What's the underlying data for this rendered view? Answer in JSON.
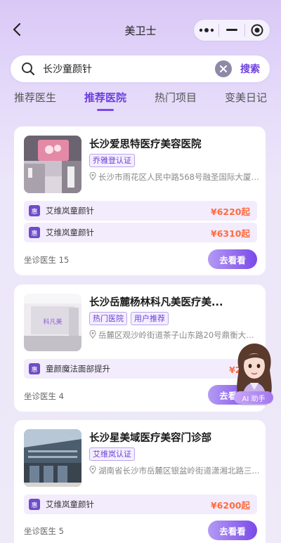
{
  "nav": {
    "title": "美卫士"
  },
  "search": {
    "query": "长沙童颜针",
    "button_label": "搜索"
  },
  "tabs": [
    {
      "label": "推荐医生",
      "active": false
    },
    {
      "label": "推荐医院",
      "active": true
    },
    {
      "label": "热门项目",
      "active": false
    },
    {
      "label": "变美日记",
      "active": false
    }
  ],
  "hospitals": [
    {
      "name": "长沙爱思特医疗美容医院",
      "tags": [
        "乔雅登认证"
      ],
      "address": "长沙市雨花区人民中路568号融圣国际大厦1...",
      "projects": [
        {
          "icon_text": "惠",
          "name": "艾维岚童颜针",
          "price": "¥6220起"
        },
        {
          "icon_text": "惠",
          "name": "艾维岚童颜针",
          "price": "¥6310起"
        }
      ],
      "doctor_count": "坐诊医生 15",
      "go_label": "去看看"
    },
    {
      "name": "长沙岳麓杨林科凡美医疗美...",
      "tags": [
        "热门医院",
        "用户推荐"
      ],
      "address": "岳麓区观沙岭街道茶子山东路20号鼎衡大厦6...",
      "projects": [
        {
          "icon_text": "惠",
          "name": "童颜魔法面部提升",
          "price": "¥2九"
        }
      ],
      "doctor_count": "坐诊医生 4",
      "go_label": "去看看"
    },
    {
      "name": "长沙星美域医疗美容门诊部",
      "tags": [
        "艾维岚认证"
      ],
      "address": "湖南省长沙市岳麓区银盆岭街道潇湘北路三...",
      "projects": [
        {
          "icon_text": "惠",
          "name": "艾维岚童颜针",
          "price": "¥6200起"
        }
      ],
      "doctor_count": "坐诊医生 5",
      "go_label": "去看看"
    }
  ],
  "ai_assistant": {
    "label": "AI 助手"
  },
  "colors": {
    "accent": "#7a4ae8",
    "price": "#ff6b3d",
    "tag_text": "#6a3fd6"
  }
}
